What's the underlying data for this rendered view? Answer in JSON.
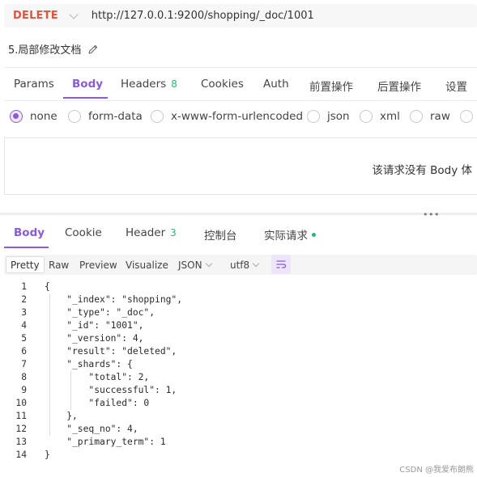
{
  "request": {
    "method": "DELETE",
    "url": "http://127.0.0.1:9200/shopping/_doc/1001",
    "doc_title": "5.局部修改文档"
  },
  "req_tabs": [
    {
      "label": "Params"
    },
    {
      "label": "Body",
      "active": true
    },
    {
      "label": "Headers",
      "count": "8"
    },
    {
      "label": "Cookies"
    },
    {
      "label": "Auth"
    },
    {
      "label": "前置操作"
    },
    {
      "label": "后置操作"
    },
    {
      "label": "设置"
    }
  ],
  "body_types": [
    {
      "label": "none",
      "checked": true
    },
    {
      "label": "form-data"
    },
    {
      "label": "x-www-form-urlencoded"
    },
    {
      "label": "json"
    },
    {
      "label": "xml"
    },
    {
      "label": "raw"
    },
    {
      "label": ""
    }
  ],
  "body_empty_text": "该请求没有 Body 体",
  "resp_tabs": [
    {
      "label": "Body",
      "active": true
    },
    {
      "label": "Cookie"
    },
    {
      "label": "Header",
      "count": "3"
    },
    {
      "label": "控制台"
    },
    {
      "label": "实际请求",
      "dot": true
    }
  ],
  "format_bar": {
    "views": [
      "Pretty",
      "Raw",
      "Preview",
      "Visualize"
    ],
    "active_view": "Pretty",
    "format": "JSON",
    "encoding": "utf8"
  },
  "response_lines": [
    {
      "n": "1",
      "text": "{"
    },
    {
      "n": "2",
      "text": "    \"_index\": \"shopping\","
    },
    {
      "n": "3",
      "text": "    \"_type\": \"_doc\","
    },
    {
      "n": "4",
      "text": "    \"_id\": \"1001\","
    },
    {
      "n": "5",
      "text": "    \"_version\": 4,"
    },
    {
      "n": "6",
      "text": "    \"result\": \"deleted\","
    },
    {
      "n": "7",
      "text": "    \"_shards\": {"
    },
    {
      "n": "8",
      "text": "        \"total\": 2,"
    },
    {
      "n": "9",
      "text": "        \"successful\": 1,"
    },
    {
      "n": "10",
      "text": "        \"failed\": 0"
    },
    {
      "n": "11",
      "text": "    },"
    },
    {
      "n": "12",
      "text": "    \"_seq_no\": 4,"
    },
    {
      "n": "13",
      "text": "    \"_primary_term\": 1"
    },
    {
      "n": "14",
      "text": "}"
    }
  ],
  "watermark": "CSDN @我爱布朗熊",
  "colors": {
    "accent": "#8a5cd1",
    "method_delete": "#e0533f",
    "count_green": "#2bb673"
  }
}
